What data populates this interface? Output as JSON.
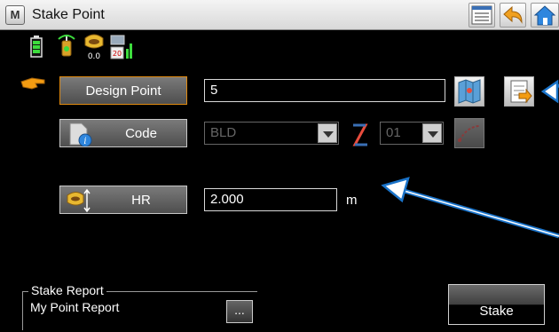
{
  "titlebar": {
    "app_icon_letter": "M",
    "title": "Stake Point",
    "icons": [
      "list-icon",
      "back-arrow-icon",
      "home-icon"
    ]
  },
  "status_icons": [
    "battery-icon",
    "radio-icon",
    "receiver-icon",
    "satellites-icon"
  ],
  "design_point": {
    "button_label": "Design Point",
    "value": "5",
    "marker_icon": "pointer-hand-icon",
    "map_button_icon": "map-icon",
    "list_button_icon": "point-list-icon"
  },
  "code": {
    "button_label": "Code",
    "value": "BLD",
    "line_icon": "linework-icon",
    "line_value": "01",
    "curve_button_icon": "curve-icon"
  },
  "hr": {
    "button_label": "HR",
    "value": "2.000",
    "unit": "m"
  },
  "stake_report": {
    "legend": "Stake Report",
    "value": "My Point Report",
    "browse_label": "..."
  },
  "stake_button": {
    "label": "Stake"
  },
  "colors": {
    "annotation_arrow": "#1a73c9",
    "pointer_hand": "#f39c12"
  }
}
